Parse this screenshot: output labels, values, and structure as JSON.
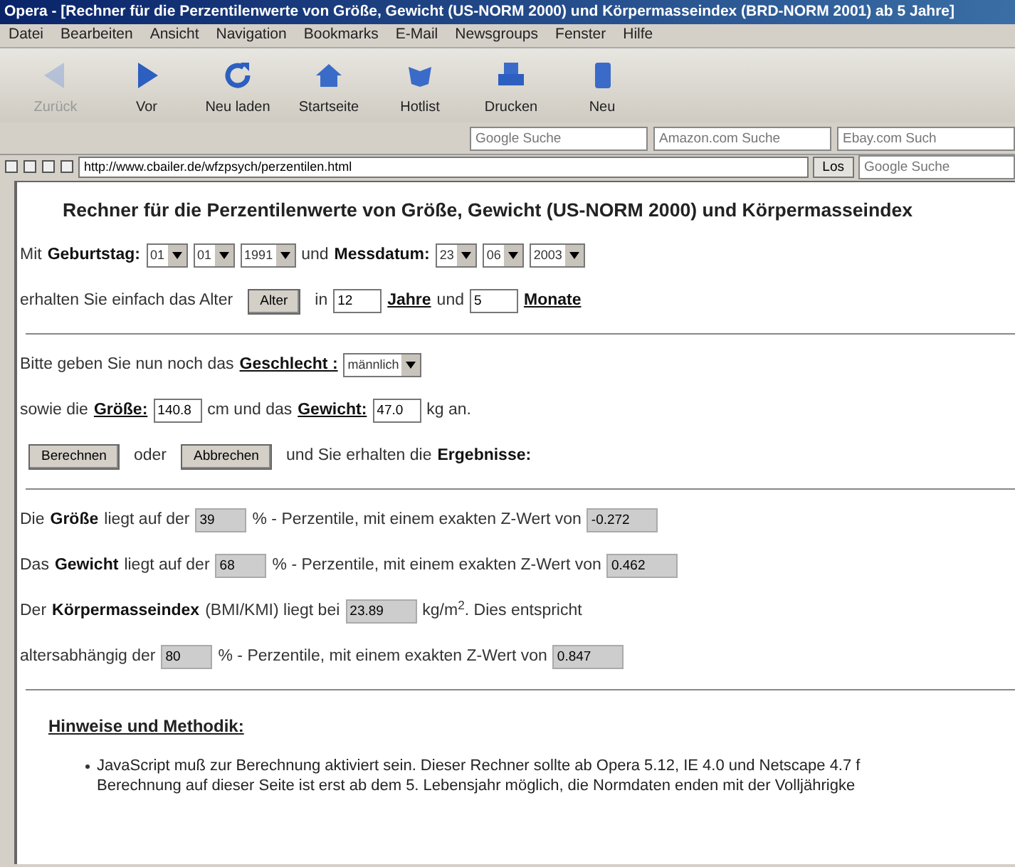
{
  "window": {
    "title": "Opera - [Rechner für die Perzentilenwerte von Größe, Gewicht (US-NORM 2000) und Körpermasseindex (BRD-NORM 2001) ab 5 Jahre]"
  },
  "menu": [
    "Datei",
    "Bearbeiten",
    "Ansicht",
    "Navigation",
    "Bookmarks",
    "E-Mail",
    "Newsgroups",
    "Fenster",
    "Hilfe"
  ],
  "toolbar": [
    {
      "kind": "back",
      "label": "Zurück",
      "disabled": true
    },
    {
      "kind": "forward",
      "label": "Vor",
      "disabled": false
    },
    {
      "kind": "reload",
      "label": "Neu laden",
      "disabled": false
    },
    {
      "kind": "home",
      "label": "Startseite",
      "disabled": false
    },
    {
      "kind": "hotlist",
      "label": "Hotlist",
      "disabled": false
    },
    {
      "kind": "print",
      "label": "Drucken",
      "disabled": false
    },
    {
      "kind": "new",
      "label": "Neu",
      "disabled": false
    }
  ],
  "search_fields": [
    {
      "placeholder": "Google Suche"
    },
    {
      "placeholder": "Amazon.com Suche"
    },
    {
      "placeholder": "Ebay.com Such"
    }
  ],
  "address_bar": {
    "url": "http://www.cbailer.de/wfzpsych/perzentilen.html",
    "go_button": "Los",
    "search_placeholder": "Google Suche"
  },
  "page": {
    "heading": "Rechner für die Perzentilenwerte von Größe, Gewicht (US-NORM 2000) und Körpermasseindex",
    "sections": [
      [
        [
          {
            "kind": "text",
            "text": "Mit"
          },
          {
            "kind": "term",
            "text": "Geburtstag:"
          },
          {
            "kind": "select",
            "value": "01"
          },
          {
            "kind": "select",
            "value": "01"
          },
          {
            "kind": "select",
            "value": "1991"
          },
          {
            "kind": "text",
            "text": "und"
          },
          {
            "kind": "term",
            "text": "Messdatum:"
          },
          {
            "kind": "select",
            "value": "23"
          },
          {
            "kind": "select",
            "value": "06"
          },
          {
            "kind": "select",
            "value": "2003"
          }
        ],
        [
          {
            "kind": "text",
            "text": "erhalten Sie einfach das Alter"
          },
          {
            "kind": "button",
            "text": "Alter"
          },
          {
            "kind": "text",
            "text": "in"
          },
          {
            "kind": "input",
            "value": "12"
          },
          {
            "kind": "link",
            "text": "Jahre"
          },
          {
            "kind": "text",
            "text": "und"
          },
          {
            "kind": "input",
            "value": "5"
          },
          {
            "kind": "link",
            "text": "Monate"
          }
        ]
      ],
      [
        [
          {
            "kind": "text",
            "text": "Bitte geben Sie nun noch das"
          },
          {
            "kind": "link",
            "text": "Geschlecht :"
          },
          {
            "kind": "select",
            "value": "männlich"
          }
        ],
        [
          {
            "kind": "text",
            "text": "sowie die"
          },
          {
            "kind": "link",
            "text": "Größe:"
          },
          {
            "kind": "input",
            "value": "140.8"
          },
          {
            "kind": "text",
            "text": "cm  und das"
          },
          {
            "kind": "link",
            "text": "Gewicht:"
          },
          {
            "kind": "input",
            "value": "47.0"
          },
          {
            "kind": "text",
            "text": "kg an."
          }
        ],
        [
          {
            "kind": "button",
            "text": "Berechnen"
          },
          {
            "kind": "text",
            "text": "oder"
          },
          {
            "kind": "button",
            "text": "Abbrechen"
          },
          {
            "kind": "text",
            "text": "und Sie erhalten die"
          },
          {
            "kind": "term",
            "text": "Ergebnisse:"
          }
        ]
      ],
      [
        [
          {
            "kind": "text",
            "text": "Die"
          },
          {
            "kind": "term",
            "text": "Größe"
          },
          {
            "kind": "text",
            "text": "liegt auf der"
          },
          {
            "kind": "output",
            "value": "39"
          },
          {
            "kind": "text",
            "text": "% - Perzentile,   mit einem exakten Z-Wert von"
          },
          {
            "kind": "output",
            "value": "-0.272"
          }
        ],
        [
          {
            "kind": "text",
            "text": "Das"
          },
          {
            "kind": "term",
            "text": "Gewicht"
          },
          {
            "kind": "text",
            "text": "liegt auf der"
          },
          {
            "kind": "output",
            "value": "68"
          },
          {
            "kind": "text",
            "text": "% - Perzentile, mit einem exakten Z-Wert von"
          },
          {
            "kind": "output",
            "value": "0.462"
          }
        ],
        [
          {
            "kind": "text",
            "text": "Der"
          },
          {
            "kind": "term",
            "text": "Körpermasseindex"
          },
          {
            "kind": "text",
            "text": "(BMI/KMI) liegt bei"
          },
          {
            "kind": "output",
            "value": "23.89"
          },
          {
            "kind": "text",
            "text": "kg/m$^{2}$.  Dies entspricht"
          }
        ],
        [
          {
            "kind": "text",
            "text": "altersabhängig der"
          },
          {
            "kind": "output",
            "value": "80"
          },
          {
            "kind": "text",
            "text": "% - Perzentile, mit einem exakten Z-Wert von"
          },
          {
            "kind": "output",
            "value": "0.847"
          }
        ]
      ]
    ],
    "notes_heading": "Hinweise und Methodik:",
    "notes": [
      {
        "lines": [
          "JavaScript muß zur Berechnung aktiviert sein. Dieser Rechner sollte ab Opera 5.12, IE 4.0 und Netscape 4.7 f",
          "Berechnung auf dieser Seite ist erst ab dem 5. Lebensjahr möglich, die Normdaten enden mit der Volljährigke"
        ]
      }
    ]
  }
}
